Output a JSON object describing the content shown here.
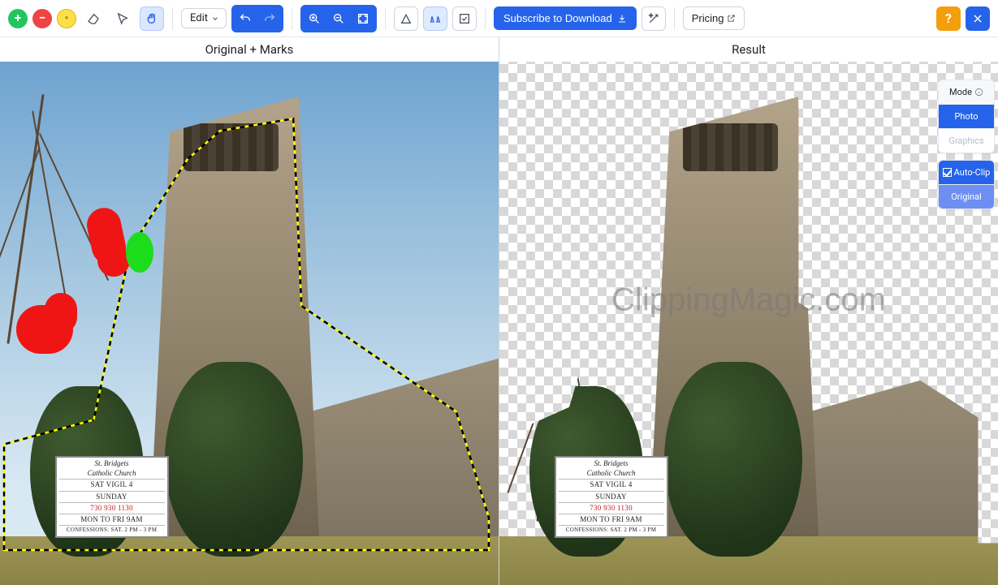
{
  "toolbar": {
    "edit_label": "Edit",
    "subscribe_label": "Subscribe to Download",
    "pricing_label": "Pricing"
  },
  "panels": {
    "left_header": "Original + Marks",
    "right_header": "Result"
  },
  "watermark": "ClippingMagic.com",
  "sign": {
    "title1": "St. Bridgets",
    "title2": "Catholic Church",
    "row1": "SAT  VIGIL  4",
    "row2": "SUNDAY",
    "row3": "730  930  1130",
    "row4": "MON TO FRI 9AM",
    "row5": "CONFESSIONS: SAT. 2 PM - 3 PM"
  },
  "sidepanel": {
    "mode_label": "Mode",
    "photo_label": "Photo",
    "graphics_label": "Graphics",
    "autoclip_label": "Auto-Clip",
    "original_label": "Original"
  }
}
